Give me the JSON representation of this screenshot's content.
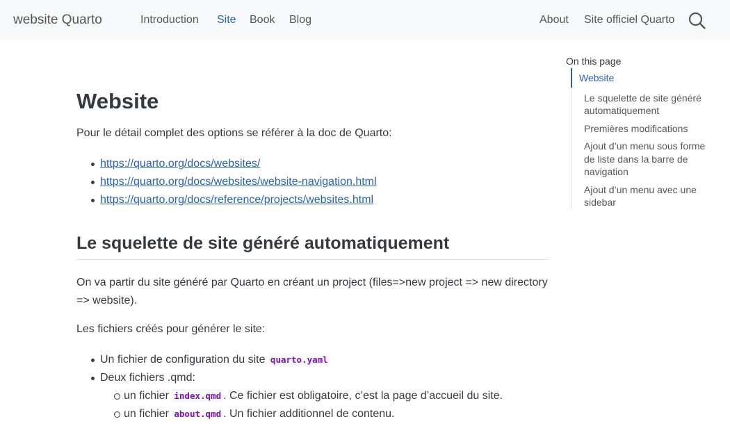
{
  "navbar": {
    "brand": "website Quarto",
    "left_links": [
      {
        "label": "Introduction"
      },
      {
        "label": "Site"
      },
      {
        "label": "Book"
      },
      {
        "label": "Blog"
      }
    ],
    "right_links": [
      {
        "label": "About"
      },
      {
        "label": "Site officiel Quarto"
      }
    ],
    "active_link": "Site",
    "search_icon": "search-icon"
  },
  "main": {
    "title": "Website",
    "intro": "Pour le détail complet des options se référer à la doc de Quarto:",
    "links": [
      "https://quarto.org/docs/websites/",
      "https://quarto.org/docs/websites/website-navigation.html",
      "https://quarto.org/docs/reference/projects/websites.html"
    ],
    "section_heading": "Le squelette de site généré automatiquement",
    "para1": "On va partir du site généré par Quarto en créant un project (files=>new project => new directory => website).",
    "para2": "Les fichiers créés pour générer le site:",
    "files": {
      "item1_text": "Un fichier de configuration du site",
      "item1_code": "quarto.yaml",
      "item2_text": "Deux fichiers .qmd:",
      "sub1_before": "un fichier",
      "sub1_code": "index.qmd",
      "sub1_after": ". Ce fichier est obligatoire, c’est la page d’accueil du site.",
      "sub2_before": "un fichier",
      "sub2_code": "about.qmd",
      "sub2_after": ". Un fichier additionnel de contenu."
    }
  },
  "toc": {
    "title": "On this page",
    "items": [
      {
        "label": "Website",
        "level": 1
      },
      {
        "label": "Le squelette de site généré automatiquement",
        "level": 2
      },
      {
        "label": "Premières modifications",
        "level": 2
      },
      {
        "label": "Ajout d’un menu sous forme de liste dans la barre de navigation",
        "level": 2
      },
      {
        "label": "Ajout d’un menu avec une sidebar",
        "level": 2
      }
    ]
  },
  "colors": {
    "accent": "#2761b7",
    "navbar_bg": "#f8f9fa",
    "code_text": "#7d12ba",
    "text": "#343a40"
  }
}
